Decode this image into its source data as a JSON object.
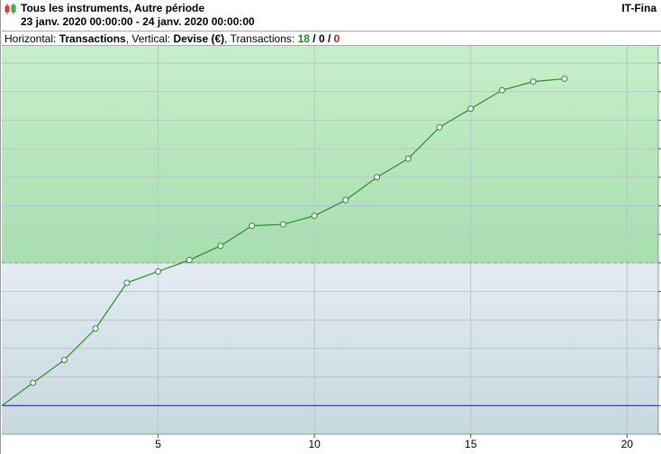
{
  "header": {
    "title": "Tous les instruments, Autre période",
    "period": "23 janv. 2020 00:00:00 - 24 janv. 2020 00:00:00",
    "brand": "IT-Fina",
    "icon": "candlestick-icon"
  },
  "infobar": {
    "horizontal_label": "Horizontal:",
    "horizontal_value": "Transactions",
    "sep1": ",",
    "vertical_label": "Vertical:",
    "vertical_value": "Devise (€)",
    "sep2": ",",
    "transactions_label": "Transactions:",
    "count_win": "18",
    "slash1": "/",
    "count_neutral": "0",
    "slash2": "/",
    "count_loss": "0"
  },
  "colors": {
    "profit_zone": "#a8e0b0",
    "loss_zone": "#cfdde3",
    "line": "#2e8b2e",
    "baseline": "#1a1a8a",
    "grid": "#b8c4c8",
    "threshold": "#6bbf6b"
  },
  "chart_data": {
    "type": "line",
    "title": "",
    "xlabel": "",
    "ylabel": "",
    "x_ticks": [
      "5",
      "10",
      "15",
      "20"
    ],
    "xlim": [
      0,
      21
    ],
    "series": [
      {
        "x": [
          0,
          1,
          2,
          3,
          4,
          5,
          6,
          7,
          8,
          9,
          10,
          11,
          12,
          13,
          14,
          15,
          16,
          17,
          18
        ],
        "values": [
          0,
          0.8,
          1.6,
          2.7,
          4.3,
          4.7,
          5.1,
          5.6,
          6.3,
          6.35,
          6.65,
          7.2,
          8.0,
          8.65,
          9.75,
          10.4,
          11.05,
          11.35,
          11.45
        ]
      }
    ],
    "baseline_value": 0,
    "threshold_value": 5.0,
    "ylim": [
      -1.0,
      12.6
    ],
    "grid": true
  }
}
